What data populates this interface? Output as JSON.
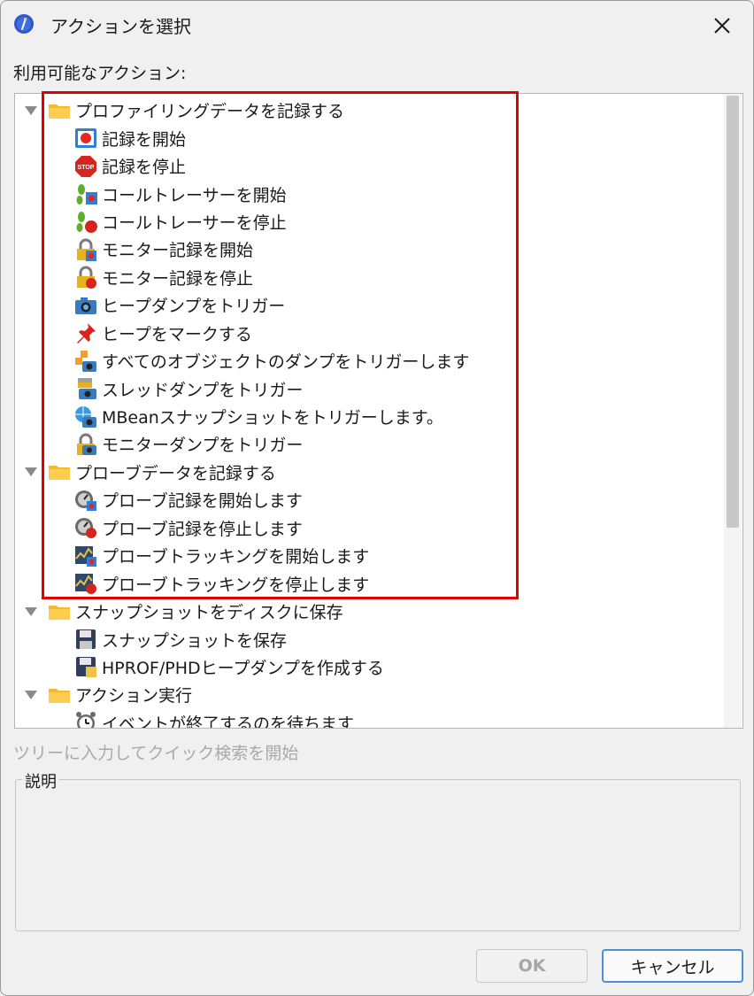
{
  "window": {
    "title": "アクションを選択"
  },
  "available_label": "利用可能なアクション:",
  "tree": {
    "groups": [
      {
        "label": "プロファイリングデータを記録する",
        "items": [
          {
            "label": "記録を開始",
            "icon": "record-start-icon"
          },
          {
            "label": "記録を停止",
            "icon": "stop-sign-icon"
          },
          {
            "label": "コールトレーサーを開始",
            "icon": "footsteps-record-icon"
          },
          {
            "label": "コールトレーサーを停止",
            "icon": "footsteps-stop-icon"
          },
          {
            "label": "モニター記録を開始",
            "icon": "lock-record-icon"
          },
          {
            "label": "モニター記録を停止",
            "icon": "lock-stop-icon"
          },
          {
            "label": "ヒープダンプをトリガー",
            "icon": "camera-icon"
          },
          {
            "label": "ヒープをマークする",
            "icon": "pushpin-icon"
          },
          {
            "label": "すべてのオブジェクトのダンプをトリガーします",
            "icon": "objects-camera-icon"
          },
          {
            "label": "スレッドダンプをトリガー",
            "icon": "thread-camera-icon"
          },
          {
            "label": "MBeanスナップショットをトリガーします。",
            "icon": "globe-camera-icon"
          },
          {
            "label": "モニターダンプをトリガー",
            "icon": "lock-camera-icon"
          }
        ]
      },
      {
        "label": "プローブデータを記録する",
        "items": [
          {
            "label": "プローブ記録を開始します",
            "icon": "probe-record-icon"
          },
          {
            "label": "プローブ記録を停止します",
            "icon": "probe-stop-icon"
          },
          {
            "label": "プローブトラッキングを開始します",
            "icon": "probe-tracking-record-icon"
          },
          {
            "label": "プローブトラッキングを停止します",
            "icon": "probe-tracking-stop-icon"
          }
        ]
      },
      {
        "label": "スナップショットをディスクに保存",
        "items": [
          {
            "label": "スナップショットを保存",
            "icon": "floppy-disk-icon"
          },
          {
            "label": "HPROF/PHDヒープダンプを作成する",
            "icon": "floppy-heap-icon"
          }
        ]
      },
      {
        "label": "アクション実行",
        "items": [
          {
            "label": "イベントが終了するのを待ちます",
            "icon": "alarm-clock-icon"
          }
        ]
      }
    ]
  },
  "search_hint": "ツリーに入力してクイック検索を開始",
  "description_label": "説明",
  "buttons": {
    "ok": "OK",
    "cancel": "キャンセル"
  },
  "colors": {
    "highlight": "#e00000",
    "folder": "#f5b82e",
    "default_button_border": "#4a8fd8"
  }
}
